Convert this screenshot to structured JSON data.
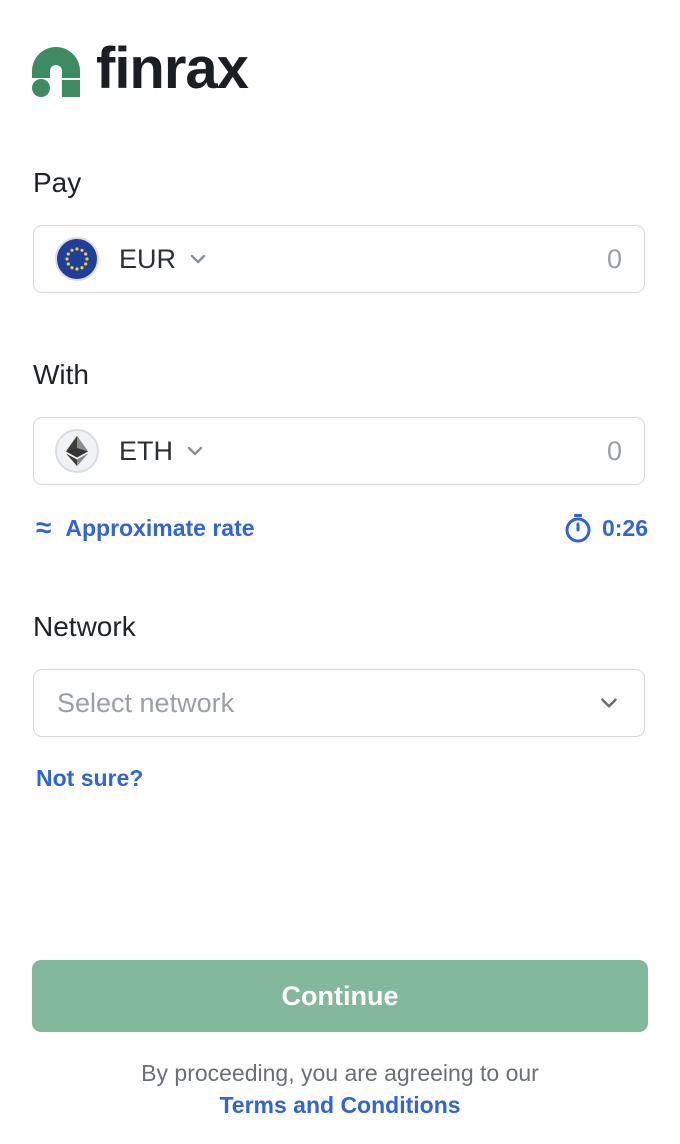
{
  "brand": {
    "name": "finrax",
    "color": "#3e8b62"
  },
  "pay": {
    "label": "Pay",
    "currency": "EUR",
    "currency_icon": "eu-flag-icon",
    "amount": "0"
  },
  "with": {
    "label": "With",
    "currency": "ETH",
    "currency_icon": "ethereum-icon",
    "amount": "0"
  },
  "rate": {
    "label": "Approximate rate",
    "symbol": "≈",
    "timer": "0:26"
  },
  "network": {
    "label": "Network",
    "placeholder": "Select network",
    "help_link": "Not sure?"
  },
  "actions": {
    "continue_label": "Continue",
    "continue_color": "#82b99c"
  },
  "legal": {
    "text": "By proceeding, you are agreeing to our",
    "link": "Terms and Conditions"
  },
  "accent_color": "#2f63e0"
}
